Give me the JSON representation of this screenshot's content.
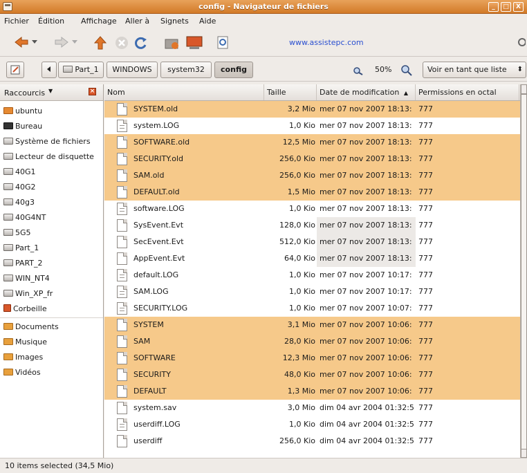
{
  "window": {
    "title": "config - Navigateur de fichiers",
    "buttons": [
      "_",
      "□",
      "X"
    ]
  },
  "menubar": [
    "Fichier",
    "Édition",
    "Affichage",
    "Aller à",
    "Signets",
    "Aide"
  ],
  "toolbar": {
    "url_text": "www.assistepc.com",
    "icons": [
      "back-arrow",
      "forward-arrow",
      "up-arrow",
      "stop",
      "reload",
      "home",
      "computer",
      "search"
    ]
  },
  "location": {
    "path_buttons": [
      "Part_1",
      "WINDOWS",
      "system32",
      "config"
    ],
    "zoom": "50%",
    "view_mode": "Voir en tant que liste"
  },
  "sidebar": {
    "header": "Raccourcis",
    "items": [
      {
        "label": "ubuntu",
        "icon": "home"
      },
      {
        "label": "Bureau",
        "icon": "desk"
      },
      {
        "label": "Système de fichiers",
        "icon": "drive"
      },
      {
        "label": "Lecteur de disquette",
        "icon": "drive"
      },
      {
        "label": "40G1",
        "icon": "drive"
      },
      {
        "label": "40G2",
        "icon": "drive"
      },
      {
        "label": "40g3",
        "icon": "drive"
      },
      {
        "label": "40G4NT",
        "icon": "drive"
      },
      {
        "label": "5G5",
        "icon": "drive"
      },
      {
        "label": "Part_1",
        "icon": "drive"
      },
      {
        "label": "PART_2",
        "icon": "drive"
      },
      {
        "label": "WIN_NT4",
        "icon": "drive"
      },
      {
        "label": "Win_XP_fr",
        "icon": "drive"
      },
      {
        "label": "Corbeille",
        "icon": "trash"
      },
      {
        "label": "Documents",
        "icon": "folder"
      },
      {
        "label": "Musique",
        "icon": "folder"
      },
      {
        "label": "Images",
        "icon": "folder"
      },
      {
        "label": "Vidéos",
        "icon": "folder"
      }
    ]
  },
  "columns": [
    "Nom",
    "Taille",
    "Date de modification",
    "Permissions en octal"
  ],
  "files": [
    {
      "name": "SYSTEM.old",
      "size": "3,2 Mio",
      "date": "mer 07 nov 2007 18:13:",
      "perm": "777",
      "selected": true,
      "lines": false
    },
    {
      "name": "system.LOG",
      "size": "1,0 Kio",
      "date": "mer 07 nov 2007 18:13:",
      "perm": "777",
      "selected": false,
      "lines": true
    },
    {
      "name": "SOFTWARE.old",
      "size": "12,5 Mio",
      "date": "mer 07 nov 2007 18:13:",
      "perm": "777",
      "selected": true,
      "lines": false
    },
    {
      "name": "SECURITY.old",
      "size": "256,0 Kio",
      "date": "mer 07 nov 2007 18:13:",
      "perm": "777",
      "selected": true,
      "lines": false
    },
    {
      "name": "SAM.old",
      "size": "256,0 Kio",
      "date": "mer 07 nov 2007 18:13:",
      "perm": "777",
      "selected": true,
      "lines": false
    },
    {
      "name": "DEFAULT.old",
      "size": "1,5 Mio",
      "date": "mer 07 nov 2007 18:13:",
      "perm": "777",
      "selected": true,
      "lines": false
    },
    {
      "name": "software.LOG",
      "size": "1,0 Kio",
      "date": "mer 07 nov 2007 18:13:",
      "perm": "777",
      "selected": false,
      "lines": true
    },
    {
      "name": "SysEvent.Evt",
      "size": "128,0 Kio",
      "date": "mer 07 nov 2007 18:13:",
      "perm": "777",
      "selected": false,
      "lines": false
    },
    {
      "name": "SecEvent.Evt",
      "size": "512,0 Kio",
      "date": "mer 07 nov 2007 18:13:",
      "perm": "777",
      "selected": false,
      "lines": false
    },
    {
      "name": "AppEvent.Evt",
      "size": "64,0 Kio",
      "date": "mer 07 nov 2007 18:13:",
      "perm": "777",
      "selected": false,
      "lines": false
    },
    {
      "name": "default.LOG",
      "size": "1,0 Kio",
      "date": "mer 07 nov 2007 10:17:",
      "perm": "777",
      "selected": false,
      "lines": true
    },
    {
      "name": "SAM.LOG",
      "size": "1,0 Kio",
      "date": "mer 07 nov 2007 10:17:",
      "perm": "777",
      "selected": false,
      "lines": true
    },
    {
      "name": "SECURITY.LOG",
      "size": "1,0 Kio",
      "date": "mer 07 nov 2007 10:07:",
      "perm": "777",
      "selected": false,
      "lines": true
    },
    {
      "name": "SYSTEM",
      "size": "3,1 Mio",
      "date": "mer 07 nov 2007 10:06:",
      "perm": "777",
      "selected": true,
      "lines": false
    },
    {
      "name": "SAM",
      "size": "28,0 Kio",
      "date": "mer 07 nov 2007 10:06:",
      "perm": "777",
      "selected": true,
      "lines": false
    },
    {
      "name": "SOFTWARE",
      "size": "12,3 Mio",
      "date": "mer 07 nov 2007 10:06:",
      "perm": "777",
      "selected": true,
      "lines": false
    },
    {
      "name": "SECURITY",
      "size": "48,0 Kio",
      "date": "mer 07 nov 2007 10:06:",
      "perm": "777",
      "selected": true,
      "lines": false
    },
    {
      "name": "DEFAULT",
      "size": "1,3 Mio",
      "date": "mer 07 nov 2007 10:06:",
      "perm": "777",
      "selected": true,
      "lines": false
    },
    {
      "name": "system.sav",
      "size": "3,0 Mio",
      "date": "dim 04 avr 2004 01:32:5",
      "perm": "777",
      "selected": false,
      "lines": false
    },
    {
      "name": "userdiff.LOG",
      "size": "1,0 Kio",
      "date": "dim 04 avr 2004 01:32:5",
      "perm": "777",
      "selected": false,
      "lines": true
    },
    {
      "name": "userdiff",
      "size": "256,0 Kio",
      "date": "dim 04 avr 2004 01:32:5",
      "perm": "777",
      "selected": false,
      "lines": false
    }
  ],
  "status": "10 items selected (34,5 Mio)",
  "colors": {
    "selection": "#f6c98a",
    "titlebar": "#d27a28"
  }
}
